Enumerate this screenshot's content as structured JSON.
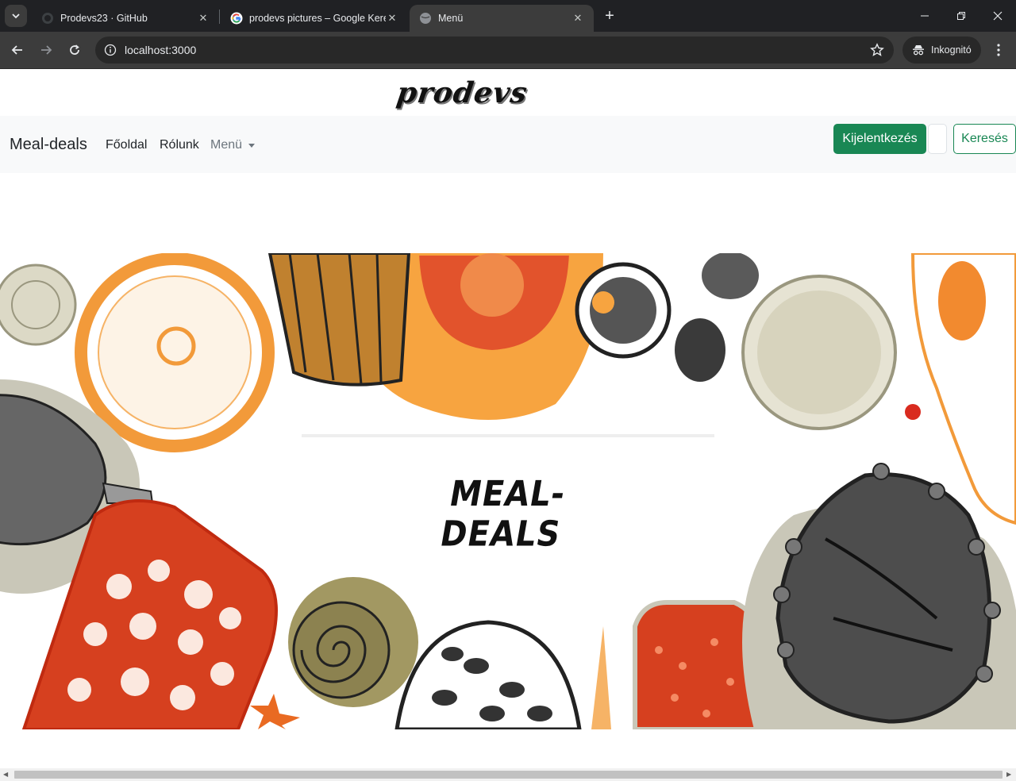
{
  "browser": {
    "tabs": [
      {
        "title": "Prodevs23 · GitHub",
        "favicon": "github-icon",
        "active": false
      },
      {
        "title": "prodevs pictures – Google Kere",
        "favicon": "google-icon",
        "active": false
      },
      {
        "title": "Menü",
        "favicon": "globe-icon",
        "active": true
      }
    ],
    "url": "localhost:3000",
    "incognito_label": "Inkognitó",
    "icons": {
      "tab_search": "chevron-down-icon",
      "new_tab": "plus-icon",
      "minimize": "minimize-icon",
      "restore": "restore-icon",
      "close": "close-icon",
      "back": "back-arrow-icon",
      "forward": "forward-arrow-icon",
      "reload": "reload-icon",
      "site_info": "info-icon",
      "bookmark": "star-icon",
      "incognito": "incognito-icon",
      "menu": "kebab-icon"
    }
  },
  "site": {
    "logo_text": "prodevs",
    "navbar": {
      "brand": "Meal-deals",
      "links": [
        "Főoldal",
        "Rólunk"
      ],
      "dropdown_label": "Menü",
      "logout_label": "Kijelentkezés",
      "search_value": "",
      "search_button": "Keresés"
    },
    "hero": {
      "text": "MEAL-DEALS"
    }
  },
  "colors": {
    "primary_green": "#198754",
    "navbar_bg": "#f8f9fa",
    "chrome_dark": "#202124",
    "hero_orange": "#f7a440",
    "hero_red": "#d6401f",
    "hero_beige": "#c9c7b8"
  }
}
